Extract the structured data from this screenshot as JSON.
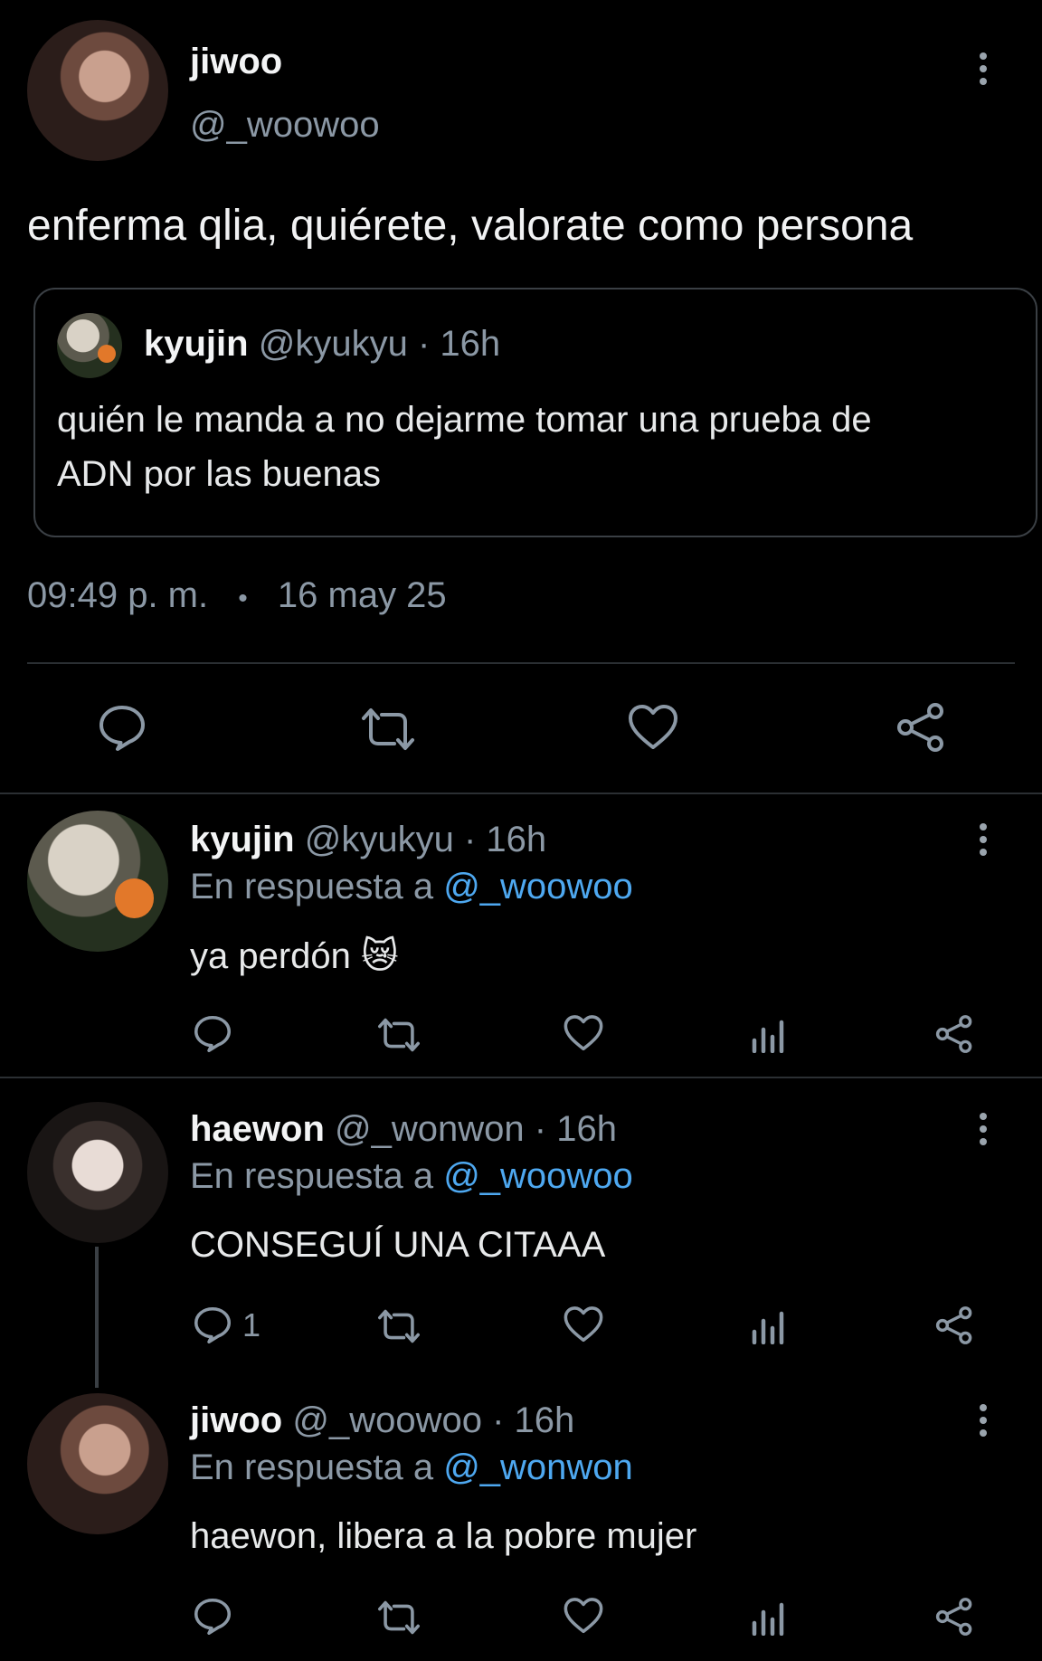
{
  "main_tweet": {
    "author_name": "jiwoo",
    "author_handle": "@_woowoo",
    "text": "enferma qlia, quiérete, valorate como persona",
    "quoted": {
      "author_name": "kyujin",
      "author_handle": "@kyukyu",
      "time": "· 16h",
      "text_line1": "quién le manda a no dejarme tomar una prueba de",
      "text_line2": "ADN por las buenas"
    },
    "time": "09:49 p. m.",
    "dot": "•",
    "date": "16 may 25"
  },
  "replies": [
    {
      "author_name": "kyujin",
      "author_handle": "@kyukyu",
      "time": "· 16h",
      "reply_prefix": "En respuesta a",
      "reply_to": "@_woowoo",
      "text": "ya perdón 😿",
      "reply_count": ""
    },
    {
      "author_name": "haewon",
      "author_handle": "@_wonwon",
      "time": "· 16h",
      "reply_prefix": "En respuesta a",
      "reply_to": "@_woowoo",
      "text": "CONSEGUÍ UNA CITAAA",
      "reply_count": "1"
    },
    {
      "author_name": "jiwoo",
      "author_handle": "@_woowoo",
      "time": "· 16h",
      "reply_prefix": "En respuesta a",
      "reply_to": "@_wonwon",
      "text": "haewon, libera a la pobre mujer",
      "reply_count": ""
    }
  ],
  "icons": {
    "reply": "reply-icon",
    "retweet": "retweet-icon",
    "like": "heart-icon",
    "views": "views-icon",
    "share": "share-icon",
    "more": "more-icon"
  },
  "colors": {
    "background": "#000000",
    "text": "#e7e9ea",
    "muted": "#8b98a5",
    "link": "#4ea8f0",
    "divider": "#2b2f33"
  }
}
